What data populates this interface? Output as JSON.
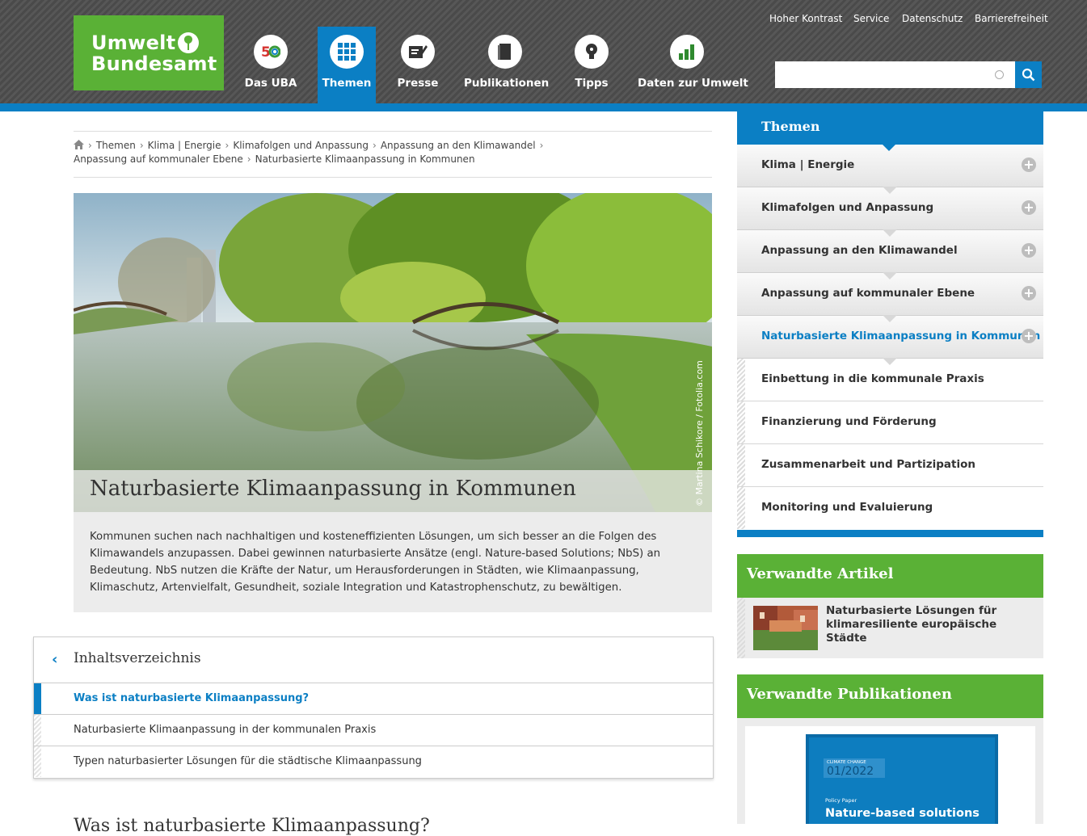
{
  "logo": {
    "line1": "Umwelt",
    "line2": "Bundesamt"
  },
  "topmeta": [
    "Hoher Kontrast",
    "Service",
    "Datenschutz",
    "Barrierefreiheit"
  ],
  "nav": [
    {
      "label": "Das UBA",
      "icon": "uba-50-icon"
    },
    {
      "label": "Themen",
      "icon": "grid-icon",
      "active": true
    },
    {
      "label": "Presse",
      "icon": "press-icon"
    },
    {
      "label": "Publikationen",
      "icon": "book-icon"
    },
    {
      "label": "Tipps",
      "icon": "lightbulb-icon"
    },
    {
      "label": "Daten zur Umwelt",
      "icon": "bar-chart-icon"
    }
  ],
  "search": {
    "placeholder": "",
    "value": ""
  },
  "breadcrumb": {
    "items": [
      "Themen",
      "Klima | Energie",
      "Klimafolgen und Anpassung",
      "Anpassung an den Klimawandel",
      "Anpassung auf kommunaler Ebene",
      "Naturbasierte Klimaanpassung in Kommunen"
    ]
  },
  "hero": {
    "title": "Naturbasierte Klimaanpassung in Kommunen",
    "credit": "© Martina Schikore / Fotolia.com",
    "teaser": "Kommunen suchen nach nachhaltigen und kosteneffizienten Lösungen, um sich besser an die Folgen des Klimawandels anzupassen. Dabei gewinnen naturbasierte Ansätze (engl. Nature-based Solutions; NbS) an Bedeutung. NbS nutzen die Kräfte der Natur, um Herausforderungen in Städten, wie Klimaanpassung, Klimaschutz, Artenvielfalt, Gesundheit, soziale Integration und Katastrophenschutz, zu bewältigen."
  },
  "toc": {
    "title": "Inhaltsverzeichnis",
    "items": [
      "Was ist naturbasierte Klimaanpassung?",
      "Naturbasierte Klimaanpassung in der kommunalen Praxis",
      "Typen naturbasierter Lösungen für die städtische Klimaanpassung"
    ]
  },
  "next_heading": "Was ist naturbasierte Klimaanpassung?",
  "sidebar": {
    "title": "Themen",
    "items": [
      "Klima | Energie",
      "Klimafolgen und Anpassung",
      "Anpassung an den Klimawandel",
      "Anpassung auf kommunaler Ebene",
      "Naturbasierte Klimaanpassung in Kommunen"
    ],
    "subitems": [
      "Einbettung in die kommunale Praxis",
      "Finanzierung und Förderung",
      "Zusammenarbeit und Partizipation",
      "Monitoring und Evaluierung"
    ]
  },
  "related": {
    "articles_title": "Verwandte Artikel",
    "article": "Naturbasierte Lösungen für klimaresiliente europäische Städte",
    "publications_title": "Verwandte Publikationen",
    "cover": {
      "series": "CLIMATE CHANGE",
      "number": "01/2022",
      "type": "Policy Paper",
      "title": "Nature-based solutions"
    }
  },
  "colors": {
    "accent": "#0b7fc4",
    "brand_green": "#5ab136",
    "header": "#4f4f4f"
  }
}
